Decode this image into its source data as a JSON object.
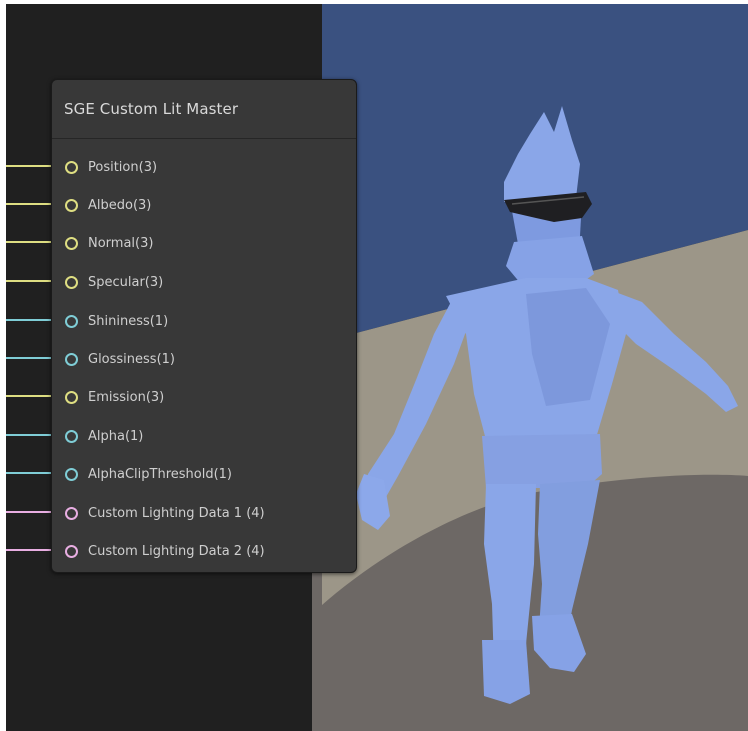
{
  "colors": {
    "graph_background": "#202020",
    "node_background": "#383838",
    "vector3_port": "#dede82",
    "float_port": "#7fcdd6",
    "vector4_port": "#e8aee2",
    "sky": "#3a5180",
    "ground_far": "#9c9688",
    "ground_near": "#6d6865",
    "character": "#8aa6e8"
  },
  "node": {
    "title": "SGE Custom Lit Master",
    "ports": [
      {
        "label": "Position(3)",
        "kind": "vector3"
      },
      {
        "label": "Albedo(3)",
        "kind": "vector3"
      },
      {
        "label": "Normal(3)",
        "kind": "vector3"
      },
      {
        "label": "Specular(3)",
        "kind": "vector3"
      },
      {
        "label": "Shininess(1)",
        "kind": "float"
      },
      {
        "label": "Glossiness(1)",
        "kind": "float"
      },
      {
        "label": "Emission(3)",
        "kind": "vector3"
      },
      {
        "label": "Alpha(1)",
        "kind": "float"
      },
      {
        "label": "AlphaClipThreshold(1)",
        "kind": "float"
      },
      {
        "label": "Custom Lighting Data 1 (4)",
        "kind": "vector4"
      },
      {
        "label": "Custom Lighting Data 2 (4)",
        "kind": "vector4"
      }
    ]
  },
  "preview": {
    "icons": [
      "character-model-icon",
      "sunglasses-icon"
    ]
  }
}
